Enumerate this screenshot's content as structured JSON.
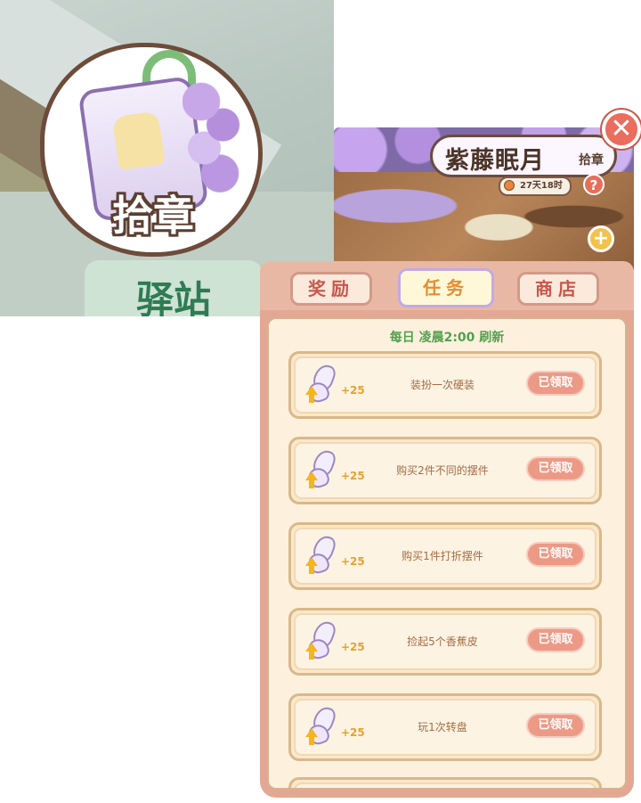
{
  "scene": {
    "badge_label": "拾章",
    "sign_text": "驿站"
  },
  "event": {
    "title": "紫藤眠月",
    "subtitle": "拾章",
    "timer": "27天18时",
    "help_icon": "?",
    "zoom_icon": "+",
    "close_icon": "✕"
  },
  "tabs": [
    {
      "label": "奖励",
      "active": false
    },
    {
      "label": "任务",
      "active": true
    },
    {
      "label": "商店",
      "active": false
    }
  ],
  "refresh_note": "每日 凌晨2:00 刷新",
  "tasks": [
    {
      "reward": "+25",
      "desc": "装扮一次硬装",
      "button": "已领取"
    },
    {
      "reward": "+25",
      "desc": "购买2件不同的摆件",
      "button": "已领取"
    },
    {
      "reward": "+25",
      "desc": "购买1件打折摆件",
      "button": "已领取"
    },
    {
      "reward": "+25",
      "desc": "捡起5个香蕉皮",
      "button": "已领取"
    },
    {
      "reward": "+25",
      "desc": "玩1次转盘",
      "button": "已领取"
    }
  ],
  "colors": {
    "accent_tab": "#e58d31",
    "tab_text": "#c8574b",
    "refresh_text": "#55a04e",
    "claim_button": "#ec9a86",
    "panel_border": "#e2a894"
  },
  "icons": [
    "butterfly-icon",
    "up-arrow-icon",
    "clock-icon",
    "help-icon",
    "zoom-in-icon",
    "close-icon"
  ]
}
